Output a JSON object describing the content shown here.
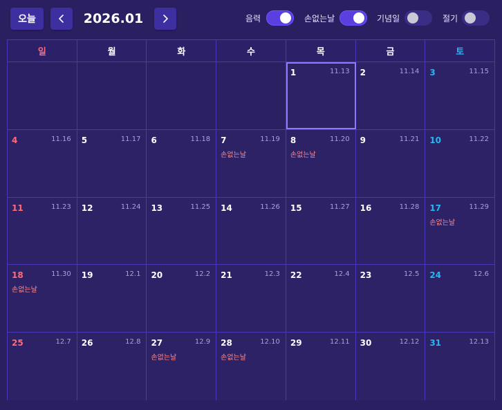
{
  "toolbar": {
    "today_label": "오늘",
    "title": "2026.01",
    "toggles": [
      {
        "label": "음력",
        "on": true
      },
      {
        "label": "손없는날",
        "on": true
      },
      {
        "label": "기념일",
        "on": false
      },
      {
        "label": "절기",
        "on": false
      }
    ]
  },
  "weekdays": [
    "일",
    "월",
    "화",
    "수",
    "목",
    "금",
    "토"
  ],
  "weeks": [
    [
      {
        "day": "",
        "lunar": "",
        "event": ""
      },
      {
        "day": "",
        "lunar": "",
        "event": ""
      },
      {
        "day": "",
        "lunar": "",
        "event": ""
      },
      {
        "day": "",
        "lunar": "",
        "event": ""
      },
      {
        "day": "1",
        "lunar": "11.13",
        "event": ""
      },
      {
        "day": "2",
        "lunar": "11.14",
        "event": ""
      },
      {
        "day": "3",
        "lunar": "11.15",
        "event": ""
      }
    ],
    [
      {
        "day": "4",
        "lunar": "11.16",
        "event": ""
      },
      {
        "day": "5",
        "lunar": "11.17",
        "event": ""
      },
      {
        "day": "6",
        "lunar": "11.18",
        "event": ""
      },
      {
        "day": "7",
        "lunar": "11.19",
        "event": "손없는날"
      },
      {
        "day": "8",
        "lunar": "11.20",
        "event": "손없는날"
      },
      {
        "day": "9",
        "lunar": "11.21",
        "event": ""
      },
      {
        "day": "10",
        "lunar": "11.22",
        "event": ""
      }
    ],
    [
      {
        "day": "11",
        "lunar": "11.23",
        "event": ""
      },
      {
        "day": "12",
        "lunar": "11.24",
        "event": ""
      },
      {
        "day": "13",
        "lunar": "11.25",
        "event": ""
      },
      {
        "day": "14",
        "lunar": "11.26",
        "event": ""
      },
      {
        "day": "15",
        "lunar": "11.27",
        "event": ""
      },
      {
        "day": "16",
        "lunar": "11.28",
        "event": ""
      },
      {
        "day": "17",
        "lunar": "11.29",
        "event": "손없는날"
      }
    ],
    [
      {
        "day": "18",
        "lunar": "11.30",
        "event": "손없는날"
      },
      {
        "day": "19",
        "lunar": "12.1",
        "event": ""
      },
      {
        "day": "20",
        "lunar": "12.2",
        "event": ""
      },
      {
        "day": "21",
        "lunar": "12.3",
        "event": ""
      },
      {
        "day": "22",
        "lunar": "12.4",
        "event": ""
      },
      {
        "day": "23",
        "lunar": "12.5",
        "event": ""
      },
      {
        "day": "24",
        "lunar": "12.6",
        "event": ""
      }
    ],
    [
      {
        "day": "25",
        "lunar": "12.7",
        "event": ""
      },
      {
        "day": "26",
        "lunar": "12.8",
        "event": ""
      },
      {
        "day": "27",
        "lunar": "12.9",
        "event": "손없는날"
      },
      {
        "day": "28",
        "lunar": "12.10",
        "event": "손없는날"
      },
      {
        "day": "29",
        "lunar": "12.11",
        "event": ""
      },
      {
        "day": "30",
        "lunar": "12.12",
        "event": ""
      },
      {
        "day": "31",
        "lunar": "12.13",
        "event": ""
      }
    ]
  ],
  "today": "1",
  "colors": {
    "background": "#2a1f60",
    "accent": "#5b3fe0",
    "sunday": "#ff6b7a",
    "saturday": "#27b6f0",
    "event": "#ff8a8a"
  },
  "icons": {
    "prev": "chevron-left-icon",
    "next": "chevron-right-icon"
  }
}
